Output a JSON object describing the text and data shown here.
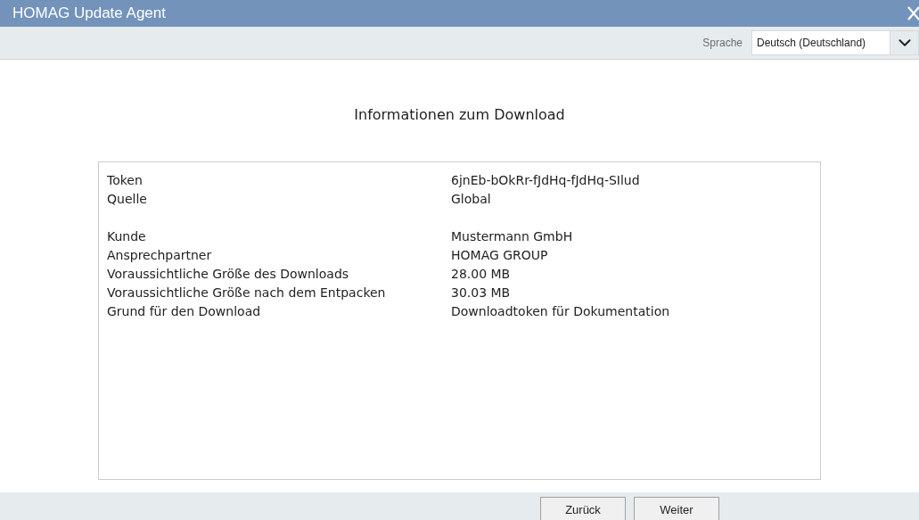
{
  "window": {
    "title": "HOMAG Update Agent"
  },
  "language": {
    "label": "Sprache",
    "value": "Deutsch (Deutschland)"
  },
  "heading": "Informationen zum Download",
  "groups": [
    [
      {
        "label": "Token",
        "value": "6jnEb-bOkRr-fJdHq-fJdHq-SIlud"
      },
      {
        "label": "Quelle",
        "value": "Global"
      }
    ],
    [
      {
        "label": "Kunde",
        "value": "Mustermann GmbH"
      },
      {
        "label": "Ansprechpartner",
        "value": "HOMAG GROUP"
      },
      {
        "label": "Voraussichtliche Größe des Downloads",
        "value": "28.00 MB"
      },
      {
        "label": "Voraussichtliche Größe nach dem Entpacken",
        "value": "30.03 MB"
      },
      {
        "label": "Grund für den Download",
        "value": "Downloadtoken für Dokumentation"
      }
    ]
  ],
  "buttons": [
    "Zurück",
    "Weiter"
  ]
}
